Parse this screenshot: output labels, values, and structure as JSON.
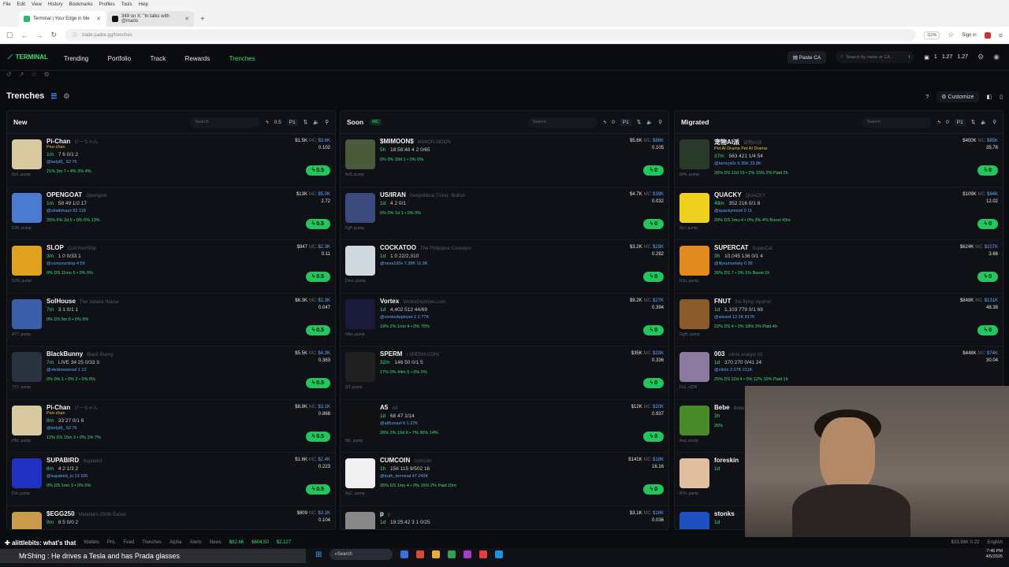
{
  "browser": {
    "menu": [
      "File",
      "Edit",
      "View",
      "History",
      "Bookmarks",
      "Profiles",
      "Tools",
      "Help"
    ],
    "tabs": [
      {
        "title": "Terminal | Your Edge in Me"
      },
      {
        "title": "349 on X: \"In talks with @mario"
      }
    ],
    "url": "trade.padre.gg/trenches",
    "zoom": "110%",
    "signin": "Sign in"
  },
  "header": {
    "logo": "TERMINAL",
    "nav": [
      "Trending",
      "Portfolio",
      "Track",
      "Rewards",
      "Trenches"
    ],
    "paste_ca": "Paste CA",
    "search_placeholder": "Search by name or CA...",
    "search_shortcut": "/",
    "wallet_count": "1",
    "wallet_a": "1.27",
    "wallet_b": "1.27"
  },
  "page": {
    "title": "Trenches",
    "customize": "Customize"
  },
  "columns": [
    {
      "title": "New",
      "search": "Search",
      "amount": "0.5",
      "preset": "P1",
      "tokens": [
        {
          "name": "Pi-Chan",
          "full": "ピーちゃん",
          "age": "1m",
          "stats": "7  6  0/1  2",
          "sub": "8sX..pump",
          "handle": "@betyl8_  62  76",
          "metrics": "21%  3m  7 • 4%  3%  4%",
          "mc": "$3.6K",
          "liq": "$1.5K",
          "vol": "0.102",
          "buy": "0.5",
          "color": "#d9c9a0",
          "tag": "Pee-chan"
        },
        {
          "name": "OPENGOAT",
          "full": "Opengoat",
          "age": "1m",
          "stats": "58  49  1/2  17",
          "sub": "G3h..pump",
          "handle": "@uloakmazz  82  118",
          "metrics": "25%  6%  2d  5 • 0%  6%  13%",
          "mc": "$5.0K",
          "liq": "$13K",
          "vol": "2.72",
          "buy": "0.5",
          "color": "#4a7bd0",
          "tag": ""
        },
        {
          "name": "SLOP",
          "full": "CoinYourSlop",
          "age": "3m",
          "stats": "1  0  0/33  1",
          "sub": "S2N..pump",
          "handle": "@coinyourslop  4  59",
          "metrics": "0%  DS 11mo  5 • 0%  0%",
          "mc": "$2.3K",
          "liq": "$947",
          "vol": "0.11",
          "buy": "0.5",
          "color": "#e0a21e",
          "tag": ""
        },
        {
          "name": "SolHouse",
          "full": "The Solana House",
          "age": "7m",
          "stats": "3  1  0/1  1",
          "sub": "A77..pump",
          "handle": "",
          "metrics": "0%  DS 9m  8 • 0%  0%",
          "mc": "$2.3K",
          "liq": "$6.3K",
          "vol": "0.047",
          "buy": "0.5",
          "color": "#3a5fa8",
          "tag": ""
        },
        {
          "name": "BlackBunny",
          "full": "Black Bunny",
          "age": "7m",
          "stats": "LIVE  34  25  0/33  3",
          "sub": "7Y1..pump",
          "handle": "@vledemeersol  1  12",
          "metrics": "0%  0%  1 • 0%  2 • 0%  0%",
          "mc": "$4.3K",
          "liq": "$5.5K",
          "vol": "0.363",
          "buy": "0.5",
          "color": "#2a3340",
          "tag": ""
        },
        {
          "name": "Pi-Chan",
          "full": "ピーちゃん",
          "age": "8m",
          "stats": "33  27  0/1  6",
          "sub": "H8z..pump",
          "handle": "@betyl8_  62  76",
          "metrics": "12%  DS 15m  3 • 0%  1%  7%",
          "mc": "$3.1K",
          "liq": "$8.9K",
          "vol": "0.868",
          "buy": "0.5",
          "color": "#d9c9a0",
          "tag": "Pee-chan"
        },
        {
          "name": "SUPABIRD",
          "full": "Supabird",
          "age": "8m",
          "stats": "4  2  1/3  2",
          "sub": "Dvt..pump",
          "handle": "@supabird_io  13  106",
          "metrics": "0%  DS 1mo  3 • 0%  0%",
          "mc": "$2.4K",
          "liq": "$1.6K",
          "vol": "0.223",
          "buy": "0.5",
          "color": "#2030c0",
          "tag": ""
        },
        {
          "name": "$EGG250",
          "full": "Melania's 250th Easter",
          "age": "9m",
          "stats": "8  5  0/0  2",
          "sub": "",
          "handle": "",
          "metrics": "",
          "mc": "$3.1K",
          "liq": "$809",
          "vol": "0.104",
          "buy": "",
          "color": "#c89a4a",
          "tag": ""
        }
      ]
    },
    {
      "title": "Soon",
      "pill": "MC",
      "search": "Search",
      "amount": "0",
      "preset": "P1",
      "tokens": [
        {
          "name": "$MIMOON$",
          "full": "MINION MOON",
          "age": "5h",
          "stats": "18:58:48  4  2  0/65",
          "sub": "Ax5..pump",
          "handle": "",
          "metrics": "0%  0%  20d  1 • 0%  0%",
          "mc": "$86K",
          "liq": "$5.6K",
          "vol": "0.105",
          "buy": "0",
          "color": "#4a5a3a",
          "tag": ""
        },
        {
          "name": "US/IRAN",
          "full": "Geopolitical Ticker: Bullish",
          "age": "1d",
          "stats": "4  2  0/1",
          "sub": "FgP..pump",
          "handle": "",
          "metrics": "0%  0% 1d  1 • 0%  0%",
          "mc": "$39K",
          "liq": "$4.7K",
          "vol": "0.032",
          "buy": "0",
          "color": "#3a4a7a",
          "tag": ""
        },
        {
          "name": "COCKATOO",
          "full": "The Philippine Cockatoo",
          "age": "1d",
          "stats": "1  0  22/2,310",
          "sub": "Dmu..pump",
          "handle": "@ness100x  7.38K  11.9K",
          "metrics": "",
          "mc": "$29K",
          "liq": "$3.2K",
          "vol": "0.282",
          "buy": "0",
          "color": "#d0d8e0",
          "tag": ""
        },
        {
          "name": "Vortex",
          "full": "VortexDeployer.com",
          "age": "1d",
          "stats": "4,402  512  44/69",
          "sub": "5Aw..pump",
          "handle": "@vortexdeployer  2  2.77K",
          "metrics": "19%  2% 1mo  4 • 0%  75%",
          "mc": "$27K",
          "liq": "$9.2K",
          "vol": "0.394",
          "buy": "0",
          "color": "#1a1a3a",
          "tag": ""
        },
        {
          "name": "SPERM",
          "full": "I SPERM COIN",
          "age": "32m",
          "stats": "146  50  0/1  5",
          "sub": "3iT..pump",
          "handle": "",
          "metrics": "17%  0%  44m  5 • 0%  0%",
          "mc": "$23K",
          "liq": "$35K",
          "vol": "0.336",
          "buy": "0",
          "color": "#202020",
          "tag": ""
        },
        {
          "name": "A5",
          "full": "A5",
          "age": "1d",
          "stats": "68  47  1/14",
          "sub": "6th..pump",
          "handle": "@alt5onsol  6  1.37K",
          "metrics": "26%  2%  16d  6 • 7%  36%  14%",
          "mc": "$20K",
          "liq": "$12K",
          "vol": "0.937",
          "buy": "0",
          "color": "#111",
          "tag": ""
        },
        {
          "name": "CUMCOIN",
          "full": "cumcoin",
          "age": "1h",
          "stats": "156  115  9/502  16",
          "sub": "5qC..pump",
          "handle": "@truth_terminal  47  245K",
          "metrics": "26%  DS 1mo  4 • 0%  15%  2%  Paid 15m",
          "mc": "$18K",
          "liq": "$141K",
          "vol": "16.16",
          "buy": "0",
          "color": "#f0f0f0",
          "tag": ""
        },
        {
          "name": "p",
          "full": "p",
          "age": "1d",
          "stats": "19:25:42  3  1  0/25",
          "sub": "",
          "handle": "",
          "metrics": "",
          "mc": "$18K",
          "liq": "$3.1K",
          "vol": "0.036",
          "buy": "",
          "color": "#888",
          "tag": ""
        }
      ]
    },
    {
      "title": "Migrated",
      "search": "Search",
      "amount": "0",
      "preset": "P1",
      "tokens": [
        {
          "name": "宠物AI派",
          "full": "宠物AI派",
          "age": "37m",
          "stats": "563  421  1/4  54",
          "sub": "EPb..pump",
          "handle": "@henrys0x  9.35K  33.8K",
          "metrics": "26%  DS  12d  19 • 0%  15%  2%  Paid 2h",
          "mc": "$85K",
          "liq": "$400K",
          "vol": "35.78",
          "buy": "0",
          "color": "#2a3a2a",
          "tag": "Pet AI Drama  Pet AI Drama"
        },
        {
          "name": "QUACKY",
          "full": "QUACKY",
          "age": "49m",
          "stats": "352  216  0/1  8",
          "sub": "6yJ..pump",
          "handle": "@quackyonsol  0  11",
          "metrics": "20%  DS 1mo  4 • 0%  3%  4%  Boost 43m",
          "mc": "$84K",
          "liq": "$109K",
          "vol": "12.02",
          "buy": "0",
          "color": "#f0d020",
          "tag": ""
        },
        {
          "name": "SUPERCAT",
          "full": "SuperCat",
          "age": "3h",
          "stats": "10,045  136  0/1  4",
          "sub": "HJu..pump",
          "handle": "@lilysunsetsky  0  39",
          "metrics": "26%  DS  7 • 0%  1%  Boost 1h",
          "mc": "$107K",
          "liq": "$624K",
          "vol": "3.66",
          "buy": "0",
          "color": "#e08a20",
          "tag": ""
        },
        {
          "name": "FNUT",
          "full": "the flying squirrel",
          "age": "1d",
          "stats": "1,103  779  0/1  69",
          "sub": "GgH..pump",
          "handle": "@wizard  12.2K  817K",
          "metrics": "22%  DS  4 • 0%  18%  3%  Paid 4h",
          "mc": "$131K",
          "liq": "$848K",
          "vol": "48.38",
          "buy": "0",
          "color": "#8a5a2a",
          "tag": ""
        },
        {
          "name": "003",
          "full": "citrini analyst #3",
          "age": "1d",
          "stats": "370  270  0/41  24",
          "sub": "Fz1..vQfX",
          "handle": "@citrini  2.27K  211K",
          "metrics": "25%  DS 22d  4 • 0%  12%  10%  Paid 1h",
          "mc": "$74K",
          "liq": "$448K",
          "vol": "30.04",
          "buy": "",
          "color": "#8a7aa0",
          "tag": ""
        },
        {
          "name": "Bebe",
          "full": "Bebe",
          "age": "3h",
          "stats": "",
          "sub": "Axp..pump",
          "handle": "",
          "metrics": "26%",
          "mc": "",
          "liq": "",
          "vol": "",
          "buy": "",
          "color": "#4a8a2a",
          "tag": ""
        },
        {
          "name": "foreskin",
          "full": "",
          "age": "1d",
          "stats": "",
          "sub": "B7b..pump",
          "handle": "",
          "metrics": "",
          "mc": "",
          "liq": "",
          "vol": "",
          "buy": "",
          "color": "#e0c0a0",
          "tag": ""
        },
        {
          "name": "stonks",
          "full": "",
          "age": "1d",
          "stats": "",
          "sub": "",
          "handle": "",
          "metrics": "",
          "mc": "",
          "liq": "",
          "vol": "",
          "buy": "",
          "color": "#2050c0",
          "tag": ""
        }
      ]
    }
  ],
  "footer": {
    "chat_user": "alittlebits",
    "chat_text": ": what's that",
    "ticker_links": [
      "Wallets",
      "PnL",
      "Feed",
      "Trenches",
      "Alpha",
      "Alerts",
      "News"
    ],
    "prices": [
      "$82.66",
      "$604.50",
      "$2,127"
    ],
    "stream_line": "MrShing : He drives a Tesla and has Prada glasses",
    "win_search": "Search",
    "right_stats": "$33.96K  0.22",
    "lang": "English",
    "time": "7:46 PM",
    "date": "4/5/2026"
  },
  "colors": {
    "accent": "#3ee07a",
    "buy": "#22c55e",
    "link": "#5fa8ff",
    "bad": "#ff5b5b"
  }
}
